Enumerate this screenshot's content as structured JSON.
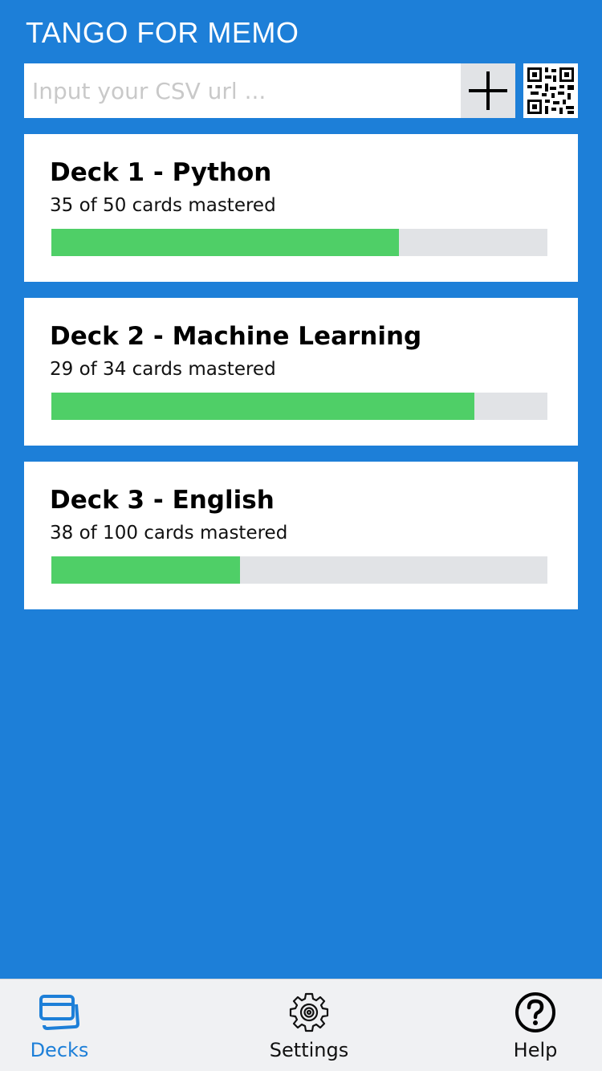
{
  "app": {
    "title": "TANGO FOR MEMO"
  },
  "search": {
    "placeholder": "Input your CSV url ...",
    "value": ""
  },
  "actions": {
    "add_icon": "plus-icon",
    "qr_icon": "qr-code-icon"
  },
  "decks": [
    {
      "title": "Deck 1 - Python",
      "subtitle": "35 of 50 cards mastered",
      "mastered": 35,
      "total": 50
    },
    {
      "title": "Deck 2 - Machine Learning",
      "subtitle": "29 of 34 cards mastered",
      "mastered": 29,
      "total": 34
    },
    {
      "title": "Deck 3 - English",
      "subtitle": "38 of 100 cards mastered",
      "mastered": 38,
      "total": 100
    }
  ],
  "tabs": [
    {
      "label": "Decks",
      "icon": "cards-icon",
      "active": true
    },
    {
      "label": "Settings",
      "icon": "gear-icon",
      "active": false
    },
    {
      "label": "Help",
      "icon": "question-circle-icon",
      "active": false
    }
  ],
  "colors": {
    "background": "#1d7fd8",
    "progress_fill": "#4fcf67",
    "progress_track": "#e1e3e6",
    "active_tab": "#1d7fd8"
  }
}
